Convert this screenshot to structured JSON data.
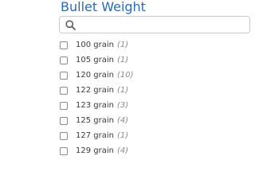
{
  "filter": {
    "title": "Bullet Weight",
    "search": {
      "placeholder": "",
      "value": "",
      "icon": "search-icon"
    },
    "options": [
      {
        "label": "100 grain",
        "count": "(1)",
        "checked": false
      },
      {
        "label": "105 grain",
        "count": "(1)",
        "checked": false
      },
      {
        "label": "120 grain",
        "count": "(10)",
        "checked": false
      },
      {
        "label": "122 grain",
        "count": "(1)",
        "checked": false
      },
      {
        "label": "123 grain",
        "count": "(3)",
        "checked": false
      },
      {
        "label": "125 grain",
        "count": "(4)",
        "checked": false
      },
      {
        "label": "127 grain",
        "count": "(1)",
        "checked": false
      },
      {
        "label": "129 grain",
        "count": "(4)",
        "checked": false
      }
    ]
  },
  "colors": {
    "title": "#2a6bb3",
    "label": "#3a3a3a",
    "count": "#8a8a8a",
    "border": "#c9c9c9"
  }
}
